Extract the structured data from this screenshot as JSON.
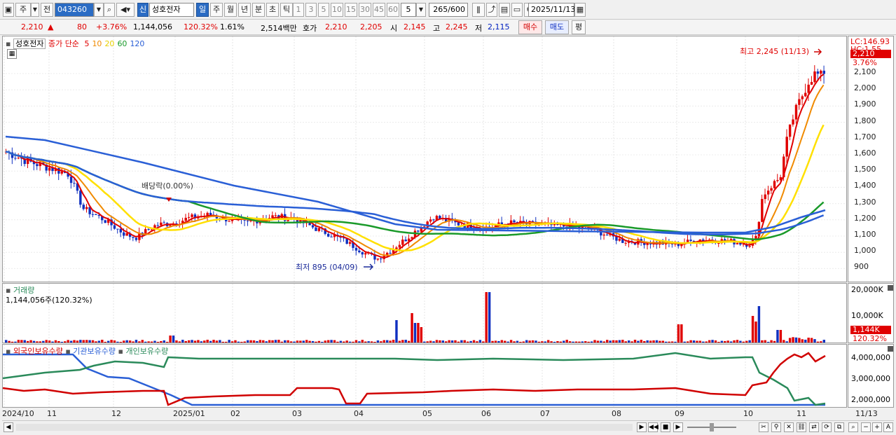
{
  "toolbar": {
    "market_type": "주",
    "compare": "전",
    "stock_code": "043260",
    "new_badge": "신",
    "stock_name": "성호전자",
    "periods": [
      {
        "label": "일",
        "active": true
      },
      {
        "label": "주",
        "active": false
      },
      {
        "label": "월",
        "active": false
      },
      {
        "label": "년",
        "active": false
      },
      {
        "label": "분",
        "active": false
      },
      {
        "label": "초",
        "active": false
      },
      {
        "label": "틱",
        "active": false
      }
    ],
    "intervals": [
      "1",
      "3",
      "5",
      "10",
      "15",
      "30",
      "45",
      "60"
    ],
    "interval_value": "5",
    "bar_count": "265",
    "bar_total": "/600",
    "date": "2025/11/13"
  },
  "quote": {
    "price": "2,210",
    "arrow": "▲",
    "change": "80",
    "change_pct": "+3.76%",
    "volume": "1,144,056",
    "volume_ratio": "120.32%",
    "turnover": "1.61%",
    "amount": "2,514백만",
    "bid_label": "호가",
    "ask_price": "2,210",
    "bid_price": "2,205",
    "open_label": "시",
    "open": "2,145",
    "high_label": "고",
    "high": "2,245",
    "low_label": "저",
    "low": "2,115",
    "buy_button": "매수",
    "sell_button": "매도",
    "eval_button": "평"
  },
  "price_panel": {
    "name": "성호전자",
    "legend_label": "종가 단순",
    "ma_labels": [
      {
        "label": "5",
        "color": "#e00000"
      },
      {
        "label": "10",
        "color": "#f08a00"
      },
      {
        "label": "20",
        "color": "#e8d000"
      },
      {
        "label": "60",
        "color": "#1a9a2a"
      },
      {
        "label": "120",
        "color": "#2a5fd6"
      }
    ],
    "lc_label": "LC:146.93",
    "hc_label": "HC:1.55",
    "current_price_label": "2,210",
    "current_pct_label": "3.76%",
    "y_ticks": [
      "2,100",
      "2,000",
      "1,900",
      "1,800",
      "1,700",
      "1,600",
      "1,500",
      "1,400",
      "1,300",
      "1,200",
      "1,100",
      "1,000",
      "900"
    ],
    "annot_high": "최고 2,245 (11/13)",
    "annot_low": "최저 895 (04/09)",
    "annot_dividend": "배당락(0.00%)"
  },
  "volume_panel": {
    "title": "거래량",
    "value_label": "1,144,056주(120.32%)",
    "y_ticks": [
      "20,000K",
      "10,000K"
    ],
    "current_label": "1,144K",
    "current_pct": "120.32%"
  },
  "holding_panel": {
    "legend": [
      {
        "label": "외국인보유수량",
        "color": "#d00000"
      },
      {
        "label": "기관보유수량",
        "color": "#2a5fd6"
      },
      {
        "label": "개인보유수량",
        "color": "#2a8a5a"
      }
    ],
    "y_ticks": [
      "4,000,000",
      "3,000,000",
      "2,000,000"
    ]
  },
  "x_axis": {
    "labels": [
      "2024/10",
      "11",
      "12",
      "2025/01",
      "02",
      "03",
      "04",
      "05",
      "06",
      "07",
      "08",
      "09",
      "10",
      "11"
    ],
    "last_date": "11/13"
  },
  "chart_data": {
    "type": "candlestick",
    "price_series_daily_approx": {
      "months": [
        "2024/10",
        "2024/11",
        "2024/12",
        "2025/01",
        "2025/02",
        "2025/03",
        "2025/04",
        "2025/05",
        "2025/06",
        "2025/07",
        "2025/08",
        "2025/09",
        "2025/10",
        "2025/11"
      ],
      "close_approx": [
        1590,
        1180,
        1130,
        1180,
        1230,
        1120,
        1000,
        1200,
        1170,
        1160,
        1080,
        1060,
        1450,
        2210
      ]
    },
    "high_marker": {
      "date": "11/13",
      "value": 2245
    },
    "low_marker": {
      "date": "04/09",
      "value": 895
    },
    "ylim": [
      850,
      2200
    ]
  },
  "colors": {
    "candle_up": "#e00000",
    "candle_down": "#1030c0",
    "ma5": "#e00000",
    "ma10": "#f08a00",
    "ma20": "#ffe000",
    "ma60": "#1a9a2a",
    "ma120": "#2a5fd6",
    "foreign": "#d00000",
    "institution": "#2a5fd6",
    "individual": "#2a8a5a"
  }
}
